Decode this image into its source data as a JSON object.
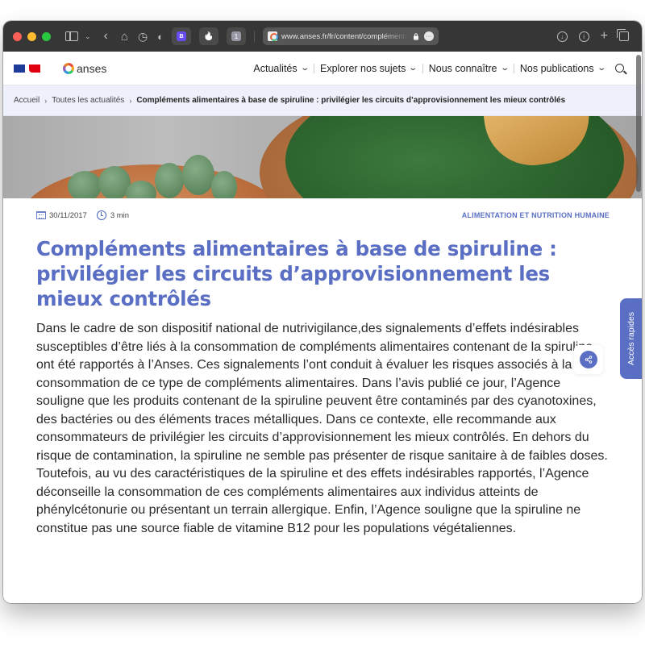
{
  "browser": {
    "url": "www.anses.fr/fr/content/compléments-",
    "extensions": [
      {
        "name": "bitwarden",
        "label": "B"
      },
      {
        "name": "flame",
        "label": "🔥"
      },
      {
        "name": "counter",
        "label": "1"
      }
    ],
    "icons": {
      "back": "‹",
      "home": "⌂",
      "history": "◷",
      "shield": "◐",
      "lock": "🔒",
      "more": "•••",
      "download": "↓",
      "info": "i",
      "plus": "+"
    }
  },
  "header": {
    "logo_text": "anses",
    "nav": [
      {
        "label": "Actualités"
      },
      {
        "label": "Explorer nos sujets"
      },
      {
        "label": "Nous connaître"
      },
      {
        "label": "Nos publications"
      }
    ],
    "chevron": "⌄"
  },
  "breadcrumb": {
    "items": [
      "Accueil",
      "Toutes les actualités"
    ],
    "current": "Compléments alimentaires à base de spiruline : privilégier les circuits d’approvisionnement les mieux contrôlés",
    "separator": "›"
  },
  "article": {
    "date": "30/11/2017",
    "read_time": "3 min",
    "category": "ALIMENTATION ET NUTRITION HUMAINE",
    "title": "Compléments alimentaires à base de spiruline : privilégier les circuits d’approvisionnement les mieux contrôlés",
    "body": "Dans le cadre de son dispositif national de nutrivigilance,des signalements d’effets indésirables susceptibles d’être liés à la consommation de compléments alimentaires contenant de la spiruline ont été rapportés à l’Anses. Ces signalements l’ont conduit à évaluer les risques associés à la consommation de ce type de compléments alimentaires. Dans l’avis publié ce jour, l’Agence souligne que les produits contenant de la spiruline peuvent être contaminés par des cyanotoxines, des bactéries ou des éléments traces métalliques. Dans ce contexte, elle recommande aux consommateurs de privilégier les circuits d’approvisionnement les mieux contrôlés. En dehors du risque de contamination, la spiruline ne semble pas présenter de risque sanitaire à de faibles doses. Toutefois, au vu des caractéristiques de la spiruline et des effets indésirables rapportés, l’Agence déconseille la consommation de ces compléments alimentaires aux individus atteints de phénylcétonurie ou présentant un terrain allergique. Enfin, l’Agence souligne que la spiruline ne constitue pas une source fiable de vitamine B12 pour les populations végétaliennes."
  },
  "share": {
    "icon": "share-icon",
    "glyph": "⋖"
  },
  "quick_access": {
    "label": "Accès rapides"
  },
  "colors": {
    "accent": "#5a6fc4",
    "breadcrumb_bg": "#eef1fb",
    "toolbar_bg": "#363636"
  }
}
